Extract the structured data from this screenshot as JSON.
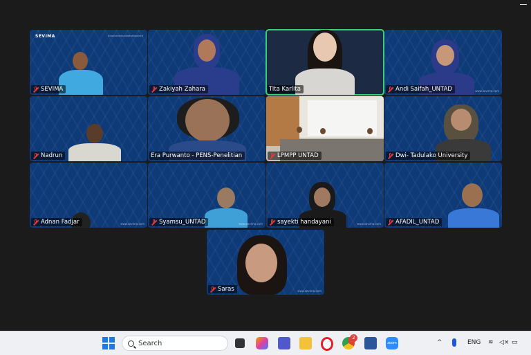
{
  "meeting": {
    "participants": [
      {
        "name": "SEVIMA"
      },
      {
        "name": "Zakiyah Zahara"
      },
      {
        "name": "Tita Karlita"
      },
      {
        "name": "Andi Saifah_UNTAD"
      },
      {
        "name": "Nadrun"
      },
      {
        "name": "Era Purwanto - PENS-Penelitian"
      },
      {
        "name": "LPMPP UNTAD"
      },
      {
        "name": "Dwi- Tadulako University"
      },
      {
        "name": "Adnan Fadjar"
      },
      {
        "name": "Syamsu_UNTAD"
      },
      {
        "name": "sayekti handayani"
      },
      {
        "name": "AFADIL_UNTAD"
      },
      {
        "name": "Saras"
      }
    ],
    "brand_text": "SEVIMA",
    "watermark_text": "www.sevima.com"
  },
  "taskbar": {
    "search_placeholder": "Search",
    "language": "ENG",
    "notification_count": "2",
    "zoom_label": "zoom"
  },
  "colors": {
    "tile_blue": "#0f3a78",
    "active_speaker": "#3ad07a",
    "mute_red": "#e03a3a"
  }
}
